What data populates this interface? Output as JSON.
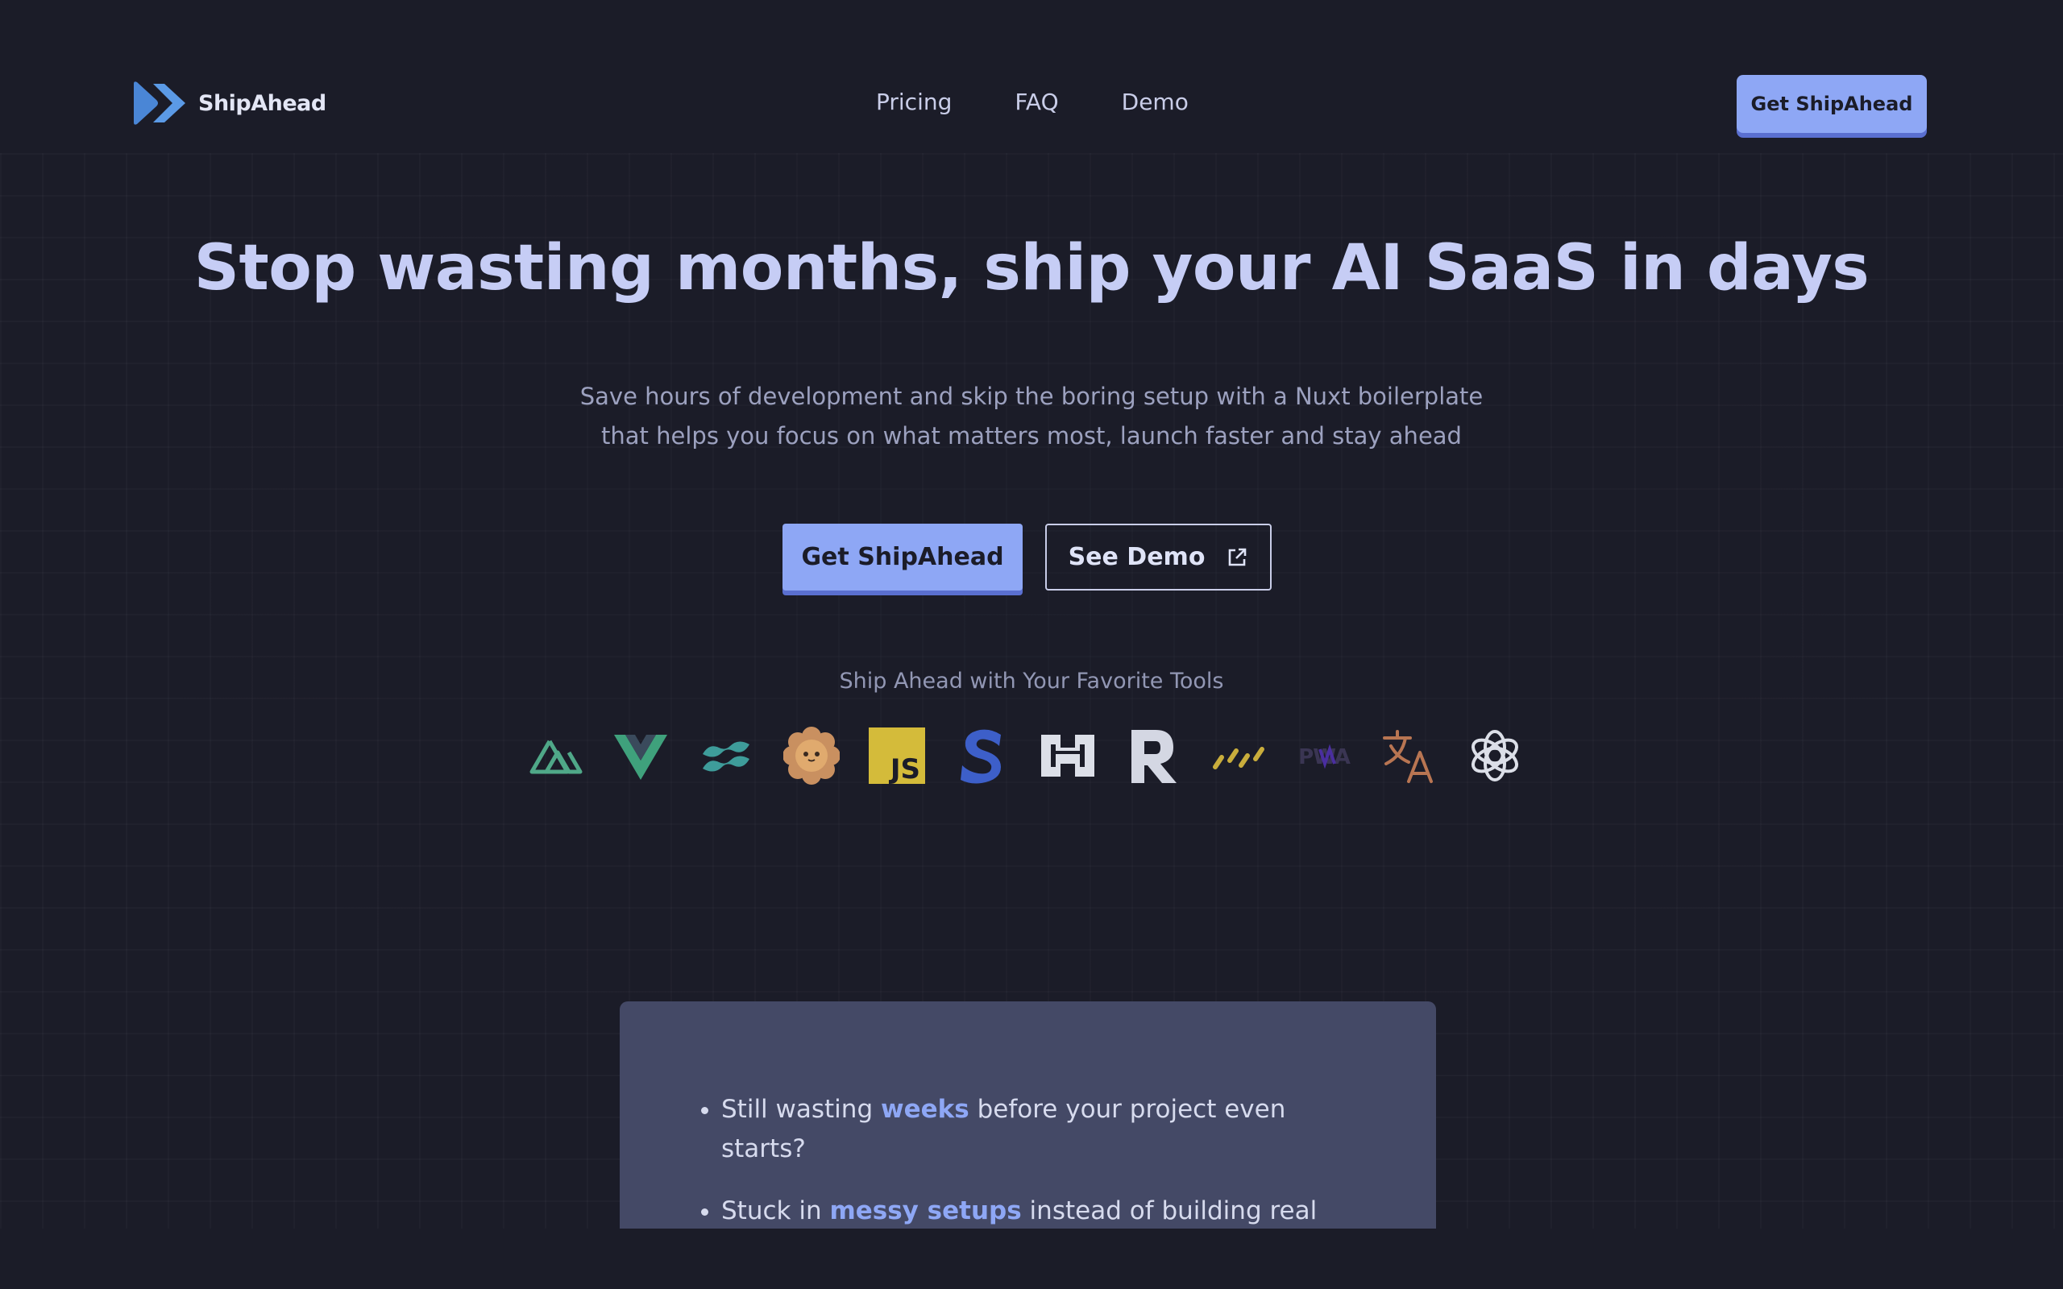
{
  "header": {
    "brand": "ShipAhead",
    "nav": [
      {
        "label": "Pricing"
      },
      {
        "label": "FAQ"
      },
      {
        "label": "Demo"
      }
    ],
    "cta_label": "Get ShipAhead"
  },
  "hero": {
    "title": "Stop wasting months, ship your AI SaaS in days",
    "subtitle_line1": "Save hours of development and skip the boring setup with a Nuxt boilerplate",
    "subtitle_line2": "that helps you focus on what matters most, launch faster and stay ahead",
    "primary_button": "Get ShipAhead",
    "secondary_button": "See Demo"
  },
  "tools": {
    "label": "Ship Ahead with Your Favorite Tools",
    "icons": [
      "nuxt-icon",
      "vue-icon",
      "tailwind-icon",
      "daisyui-icon",
      "javascript-icon",
      "stripe-icon",
      "hono-icon",
      "resend-icon",
      "drizzle-icon",
      "pwa-icon",
      "i18n-icon",
      "openai-icon"
    ],
    "js_text": "JS",
    "pwa_text": "PWA"
  },
  "pain_points": [
    {
      "before": "Still wasting ",
      "highlight": "weeks",
      "after": " before your project even starts?"
    },
    {
      "before": "Stuck in ",
      "highlight": "messy setups",
      "after": " instead of building real"
    }
  ],
  "colors": {
    "background": "#1b1c28",
    "accent": "#8ea7f5",
    "title": "#c6cdf5",
    "card": "#444966"
  }
}
